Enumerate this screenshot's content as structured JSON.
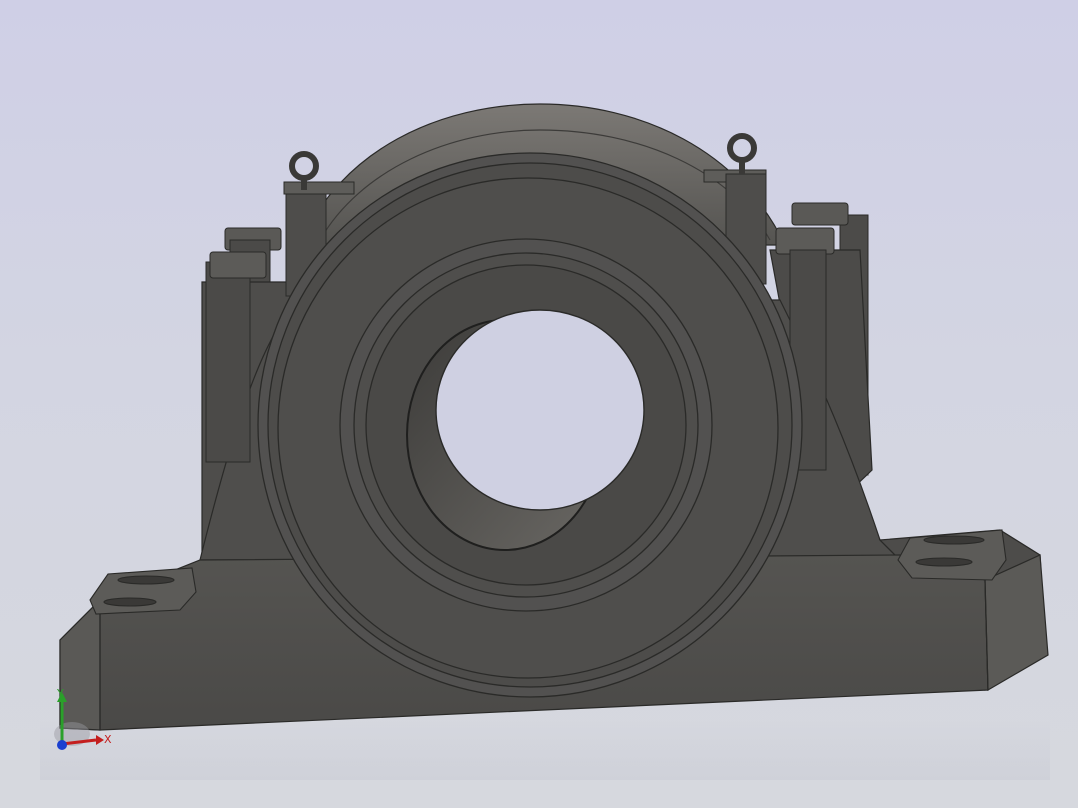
{
  "viewport": {
    "background_top": "#cfcfe6",
    "background_bottom": "#d6d8de"
  },
  "model": {
    "body_color": "#4f4e4c",
    "edge_color": "#2a2a28",
    "highlight_color": "#7a7874"
  },
  "triad": {
    "x_label": "X",
    "y_label": "Y",
    "x_color": "#c41e1e",
    "y_color": "#2aa02a",
    "z_color": "#1a3fd0"
  }
}
